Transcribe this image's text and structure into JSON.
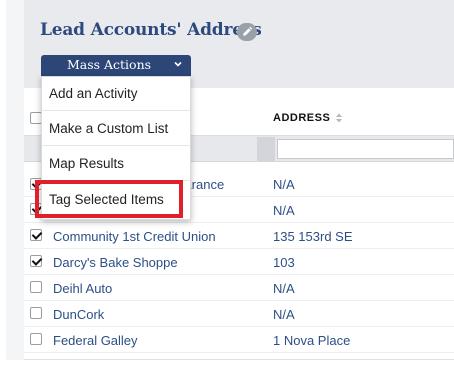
{
  "page": {
    "title": "Lead Accounts' Address",
    "edit_icon": "pencil-icon"
  },
  "mass_actions": {
    "label": "Mass Actions",
    "icon": "chevron-down-icon",
    "menu": [
      "Add an Activity",
      "Make a Custom List",
      "Map Results",
      "Tag Selected Items"
    ],
    "highlighted_item": "Tag Selected Items",
    "highlight_color": "#e01f2a"
  },
  "table": {
    "columns": [
      "",
      "ADDRESS"
    ],
    "sort_icon": "sort-arrows-icon",
    "rows": [
      {
        "checked": true,
        "name": "Arance",
        "address": "N/A"
      },
      {
        "checked": true,
        "name": "",
        "address": "N/A"
      },
      {
        "checked": true,
        "name": "Community 1st Credit Union",
        "address": "135 153rd SE"
      },
      {
        "checked": true,
        "name": "Darcy's Bake Shoppe",
        "address": "103"
      },
      {
        "checked": false,
        "name": "Deihl Auto",
        "address": "N/A"
      },
      {
        "checked": false,
        "name": "DunCork",
        "address": "N/A"
      },
      {
        "checked": false,
        "name": "Federal Galley",
        "address": "1 Nova Place"
      }
    ]
  },
  "colors": {
    "title": "#2d4a7e",
    "button_bg": "#2b4677",
    "link": "#2c4f86"
  }
}
